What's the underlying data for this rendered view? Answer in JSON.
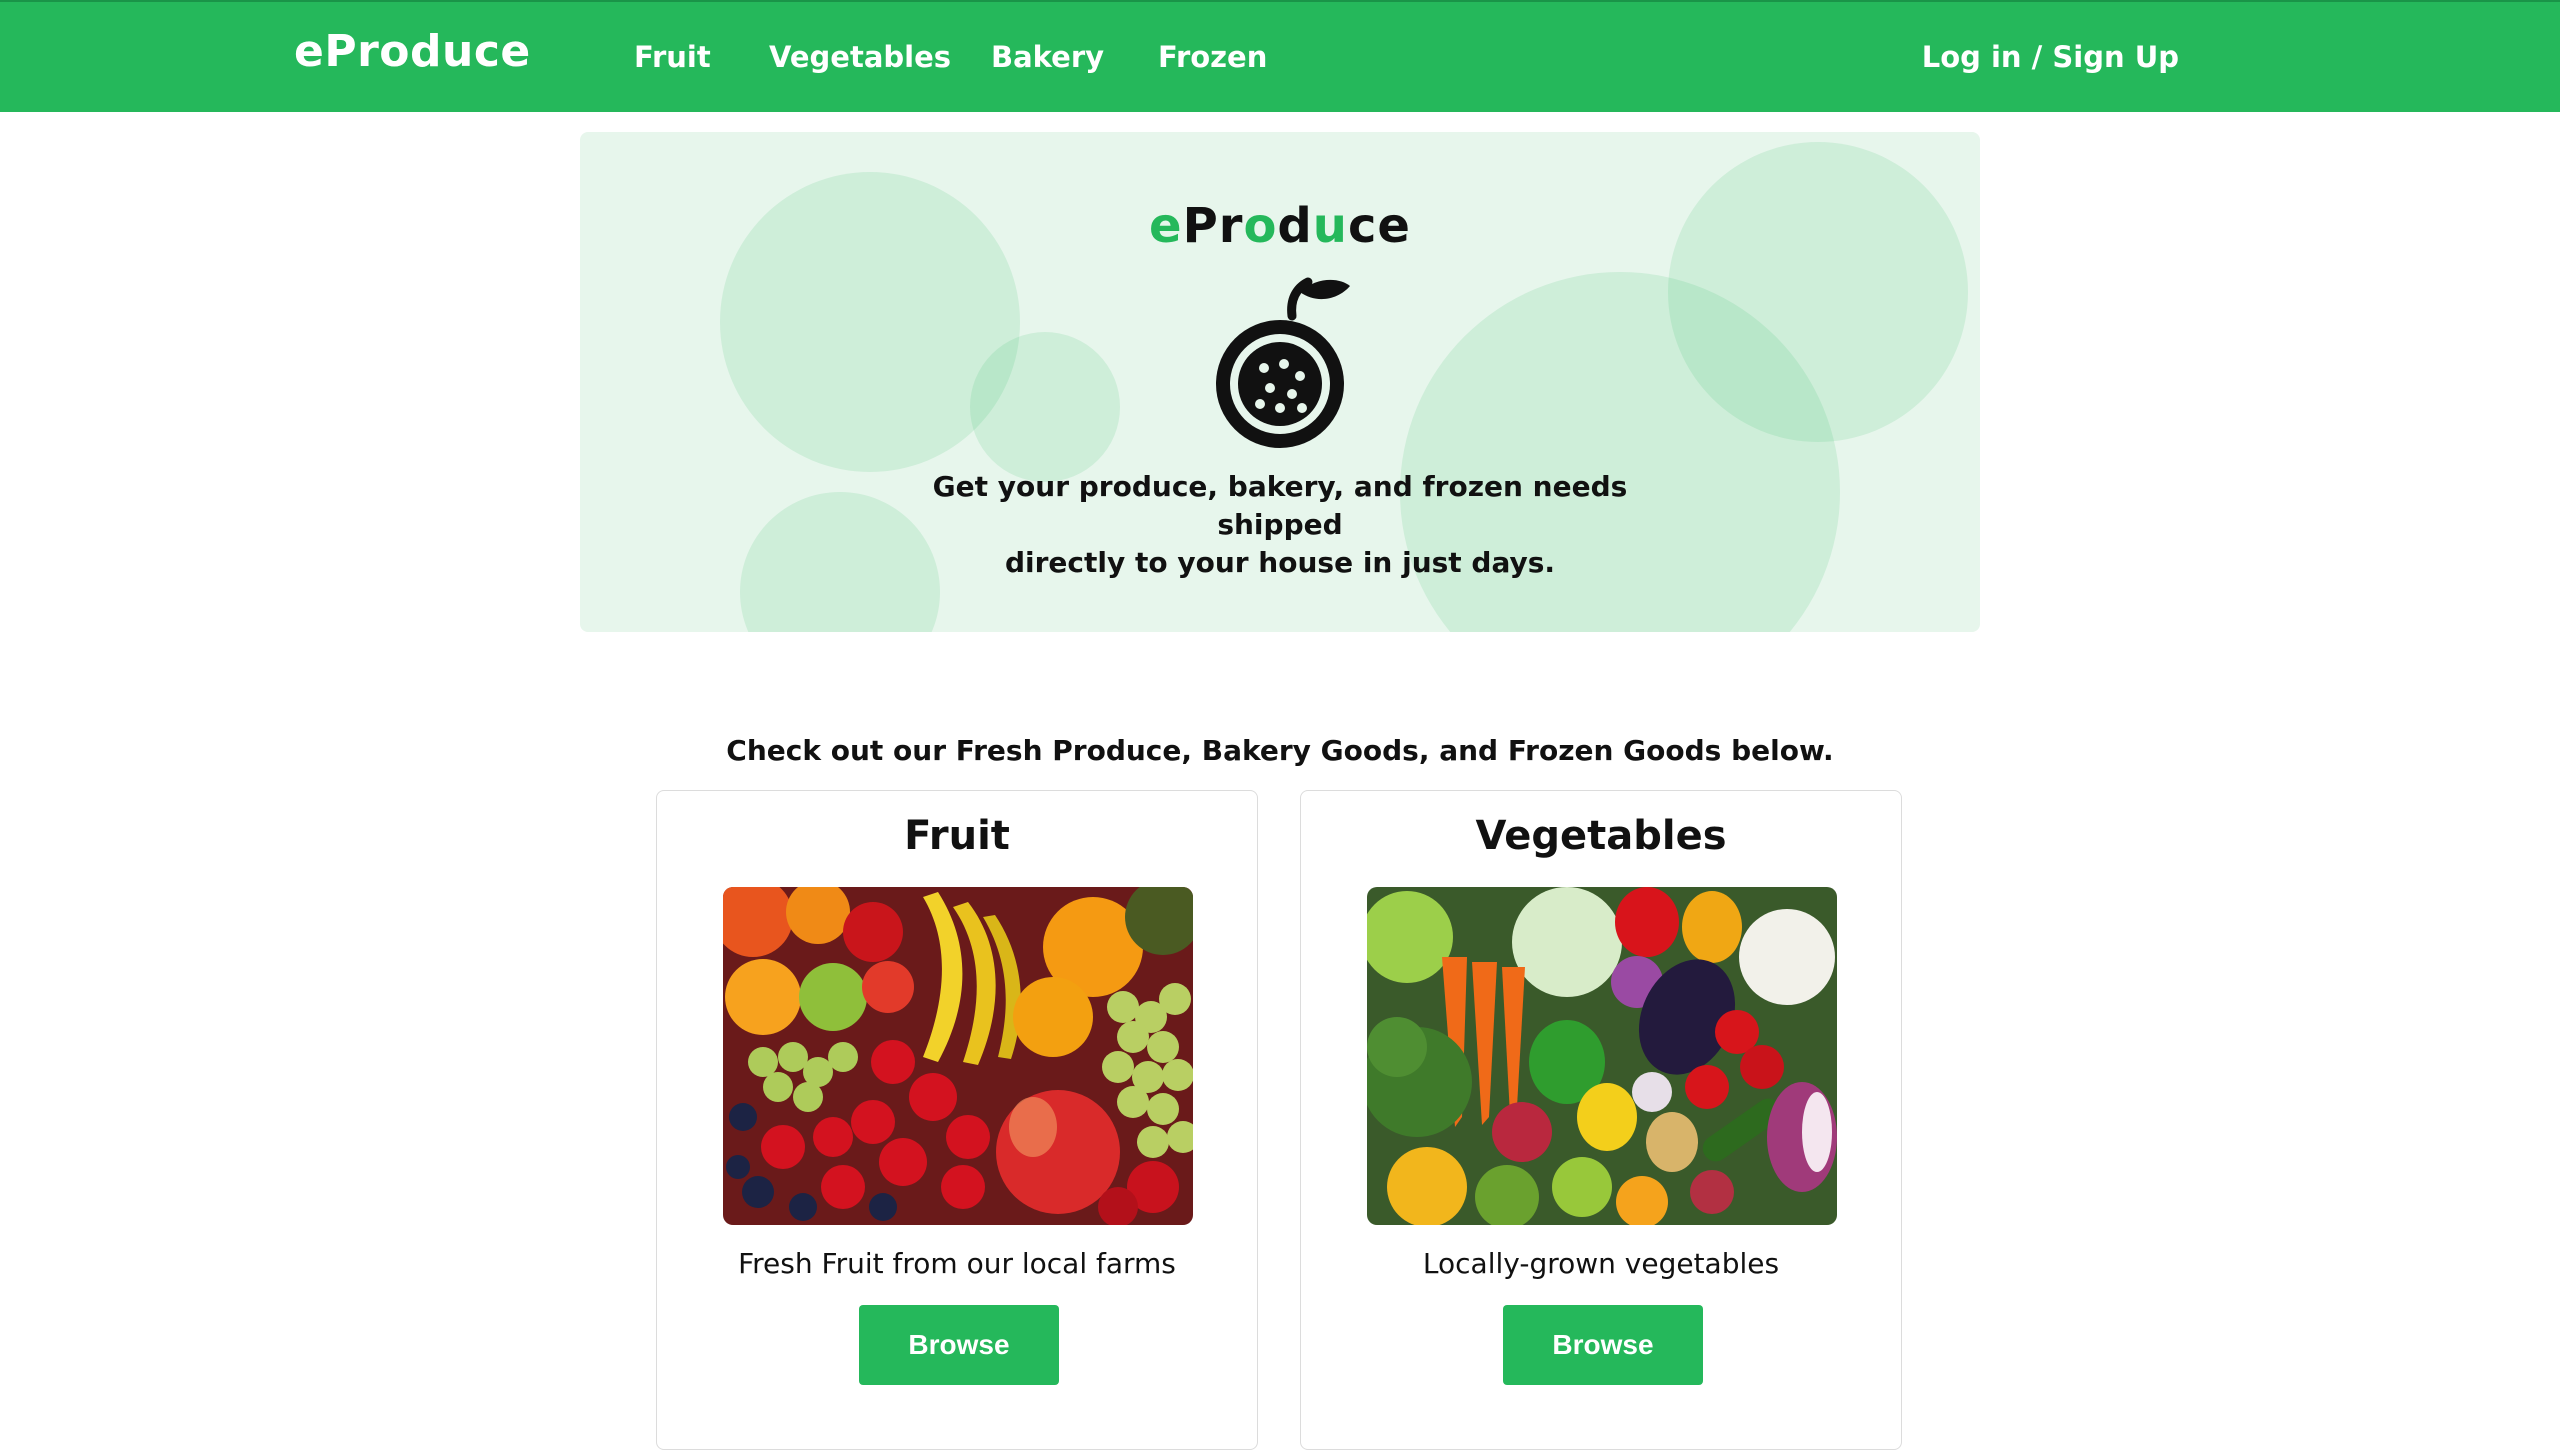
{
  "nav": {
    "brand": "eProduce",
    "links": [
      "Fruit",
      "Vegetables",
      "Bakery",
      "Frozen"
    ],
    "login": "Log in / Sign Up"
  },
  "hero": {
    "logo_parts": [
      "e",
      "P",
      "r",
      "o",
      "d",
      "u",
      "c",
      "e"
    ],
    "tagline_line1": "Get your produce, bakery, and frozen needs shipped",
    "tagline_line2": "directly to your house in just days.",
    "icon": "fruit-icon"
  },
  "intro": "Check out our Fresh Produce, Bakery Goods, and Frozen Goods below.",
  "cards": [
    {
      "title": "Fruit",
      "description": "Fresh Fruit from our local farms",
      "button": "Browse",
      "image": "fruit-photo"
    },
    {
      "title": "Vegetables",
      "description": "Locally-grown vegetables",
      "button": "Browse",
      "image": "vegetables-photo"
    }
  ],
  "colors": {
    "brand_green": "#25b85b",
    "hero_bg": "#e7f6ec"
  }
}
